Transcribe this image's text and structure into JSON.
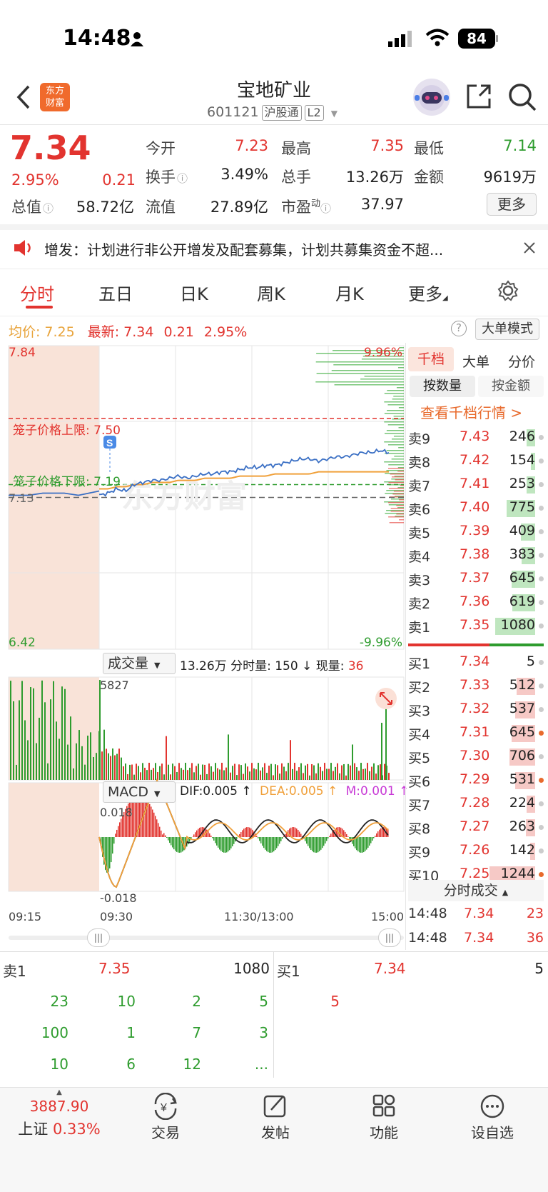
{
  "status": {
    "time": "14:48",
    "battery": "84"
  },
  "header": {
    "title": "宝地矿业",
    "code": "601121",
    "tag1": "沪股通",
    "tag2": "L2",
    "logo_l1": "东方",
    "logo_l2": "财富"
  },
  "quote": {
    "price": "7.34",
    "pct": "2.95%",
    "chg": "0.21",
    "open_label": "今开",
    "open": "7.23",
    "high_label": "最高",
    "high": "7.35",
    "low_label": "最低",
    "low": "7.14",
    "turnover_label": "换手",
    "turnover": "3.49%",
    "volume_label": "总手",
    "volume": "13.26万",
    "amount_label": "金额",
    "amount": "9619万",
    "mktcap_label": "总值",
    "mktcap": "58.72亿",
    "float_label": "流值",
    "float": "27.89亿",
    "pe_label": "市盈",
    "pe_sup": "动",
    "pe": "37.97",
    "more": "更多"
  },
  "notice": {
    "text": "增发：计划进行非公开增发及配套募集，计划共募集资金不超..."
  },
  "tabs": [
    "分时",
    "五日",
    "日K",
    "周K",
    "月K",
    "更多"
  ],
  "chart_info": {
    "avg_label": "均价:",
    "avg": "7.25",
    "last_label": "最新:",
    "last": "7.34",
    "chg": "0.21",
    "pct": "2.95%",
    "big_mode": "大单模式"
  },
  "chart_data": {
    "type": "line",
    "y_top": "7.84",
    "y_bottom": "6.42",
    "pct_top": "9.96%",
    "pct_bottom": "-9.96%",
    "prev_close": "7.13",
    "upper_limit_label": "笼子价格上限: 7.50",
    "lower_limit_label": "笼子价格下限: 7.19",
    "ylim": [
      6.42,
      7.84
    ],
    "upper_limit": 7.5,
    "lower_limit": 7.19,
    "price_line": [
      7.14,
      7.15,
      7.17,
      7.16,
      7.19,
      7.2,
      7.21,
      7.21,
      7.22,
      7.23,
      7.22,
      7.23,
      7.24,
      7.24,
      7.25,
      7.25,
      7.26,
      7.27,
      7.27,
      7.28,
      7.28,
      7.29,
      7.3,
      7.31,
      7.31,
      7.3,
      7.31,
      7.32,
      7.32,
      7.33,
      7.34,
      7.34,
      7.35,
      7.34
    ],
    "avg_line": [
      7.17,
      7.17,
      7.18,
      7.18,
      7.19,
      7.19,
      7.2,
      7.2,
      7.2,
      7.21,
      7.21,
      7.21,
      7.22,
      7.22,
      7.22,
      7.22,
      7.23,
      7.23,
      7.23,
      7.23,
      7.24,
      7.24,
      7.24,
      7.24,
      7.24,
      7.25,
      7.25,
      7.25,
      7.25,
      7.25,
      7.25,
      7.25,
      7.25,
      7.25
    ],
    "vol_label": "成交量",
    "vol_info": "13.26万 分时量: 150 ↓ 现量:",
    "vol_now": "36",
    "vol_max": "5827",
    "macd_label": "MACD",
    "dif": "DIF:0.005 ↑",
    "dea": "DEA:0.005 ↑",
    "m": "M:0.001 ↑",
    "macd_top": "0.018",
    "macd_bottom": "-0.018",
    "x_labels": [
      "09:15",
      "09:30",
      "11:30/13:00",
      "15:00"
    ]
  },
  "orderbook": {
    "tabs": [
      "千档",
      "大单",
      "分价"
    ],
    "subtabs": [
      "按数量",
      "按金额"
    ],
    "link": "查看千档行情 >",
    "asks": [
      {
        "label": "卖9",
        "price": "7.43",
        "qty": "246",
        "fill": 0.18
      },
      {
        "label": "卖8",
        "price": "7.42",
        "qty": "154",
        "fill": 0.1
      },
      {
        "label": "卖7",
        "price": "7.41",
        "qty": "253",
        "fill": 0.18
      },
      {
        "label": "卖6",
        "price": "7.40",
        "qty": "775",
        "fill": 0.62
      },
      {
        "label": "卖5",
        "price": "7.39",
        "qty": "409",
        "fill": 0.32
      },
      {
        "label": "卖4",
        "price": "7.38",
        "qty": "383",
        "fill": 0.3
      },
      {
        "label": "卖3",
        "price": "7.37",
        "qty": "645",
        "fill": 0.52
      },
      {
        "label": "卖2",
        "price": "7.36",
        "qty": "619",
        "fill": 0.5
      },
      {
        "label": "卖1",
        "price": "7.35",
        "qty": "1080",
        "fill": 0.87
      }
    ],
    "bids": [
      {
        "label": "买1",
        "price": "7.34",
        "qty": "5",
        "fill": 0.0
      },
      {
        "label": "买2",
        "price": "7.33",
        "qty": "512",
        "fill": 0.41
      },
      {
        "label": "买3",
        "price": "7.32",
        "qty": "537",
        "fill": 0.43
      },
      {
        "label": "买4",
        "price": "7.31",
        "qty": "645",
        "fill": 0.52
      },
      {
        "label": "买5",
        "price": "7.30",
        "qty": "706",
        "fill": 0.57
      },
      {
        "label": "买6",
        "price": "7.29",
        "qty": "531",
        "fill": 0.43
      },
      {
        "label": "买7",
        "price": "7.28",
        "qty": "224",
        "fill": 0.18
      },
      {
        "label": "买8",
        "price": "7.27",
        "qty": "263",
        "fill": 0.21
      },
      {
        "label": "买9",
        "price": "7.26",
        "qty": "142",
        "fill": 0.11
      },
      {
        "label": "买10",
        "price": "7.25",
        "qty": "1244",
        "fill": 1.0
      }
    ],
    "ticks_label": "分时成交",
    "ticks": [
      {
        "time": "14:48",
        "price": "7.34",
        "qty": "23"
      },
      {
        "time": "14:48",
        "price": "7.34",
        "qty": "36"
      }
    ]
  },
  "queue": {
    "sell_label": "卖1",
    "sell_price": "7.35",
    "sell_total": "1080",
    "buy_label": "买1",
    "buy_price": "7.34",
    "buy_total": "5",
    "sell_items": [
      "23",
      "10",
      "2",
      "5",
      "100",
      "1",
      "7",
      "3",
      "10",
      "6",
      "12",
      "..."
    ],
    "buy_items": [
      "5"
    ]
  },
  "bottom_nav": {
    "index_value": "3887.90",
    "index_name": "上证",
    "index_pct": "0.33%",
    "items": [
      "交易",
      "发帖",
      "功能",
      "设自选"
    ]
  }
}
